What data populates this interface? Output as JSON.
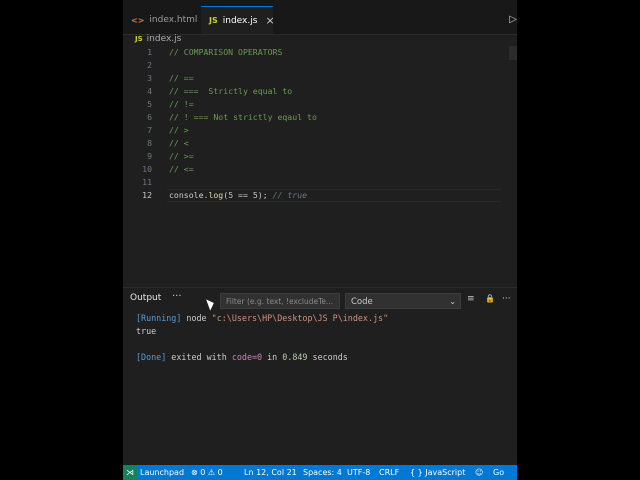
{
  "tabs": [
    {
      "icon": "<>",
      "label": "index.html",
      "close": "×"
    },
    {
      "icon": "JS",
      "label": "index.js",
      "close": "×"
    }
  ],
  "breadcrumb": {
    "icon": "JS",
    "file": "index.js"
  },
  "editor": {
    "lines": [
      {
        "n": "1",
        "text": "// COMPARISON OPERATORS"
      },
      {
        "n": "2",
        "text": ""
      },
      {
        "n": "3",
        "text": "// =="
      },
      {
        "n": "4",
        "text": "// ===  Strictly equal to"
      },
      {
        "n": "5",
        "text": "// !="
      },
      {
        "n": "6",
        "text": "// ! === Not strictly eqaul to"
      },
      {
        "n": "7",
        "text": "// >"
      },
      {
        "n": "8",
        "text": "// <"
      },
      {
        "n": "9",
        "text": "// >="
      },
      {
        "n": "10",
        "text": "// <="
      },
      {
        "n": "11",
        "text": ""
      }
    ],
    "active_line": {
      "n": "12",
      "obj": "console",
      "dot": ".",
      "fn": "log",
      "open": "(",
      "a": "5",
      "op": " == ",
      "b": "5",
      "close": ");",
      "ghost": " // true"
    }
  },
  "panel": {
    "tab": "Output",
    "more": "···",
    "filter_placeholder": "Filter (e.g. text, !excludeTe...",
    "channel": "Code",
    "chevron": "⌄",
    "btn_clear": "≡",
    "btn_lock": "🔒",
    "btn_more": "···",
    "output": {
      "running": "[Running]",
      "cmd": " node ",
      "path": "\"c:\\Users\\HP\\Desktop\\JS P\\index.js\"",
      "result": "true",
      "done": "[Done]",
      "exited": " exited with ",
      "code": "code=0",
      "in": " in ",
      "secs": "0.849",
      "seconds": " seconds"
    }
  },
  "statusbar": {
    "remote": "⋊",
    "launchpad": "Launchpad",
    "problems": "⊗ 0 ⚠ 0",
    "position": "Ln 12, Col 21",
    "spaces": "Spaces: 4",
    "encoding": "UTF-8",
    "eol": "CRLF",
    "language": "{ } JavaScript",
    "go": "Go"
  },
  "colors": {
    "accent": "#0078d4",
    "comment": "#6a9955",
    "function": "#dcdcaa",
    "number": "#b5cea8"
  }
}
